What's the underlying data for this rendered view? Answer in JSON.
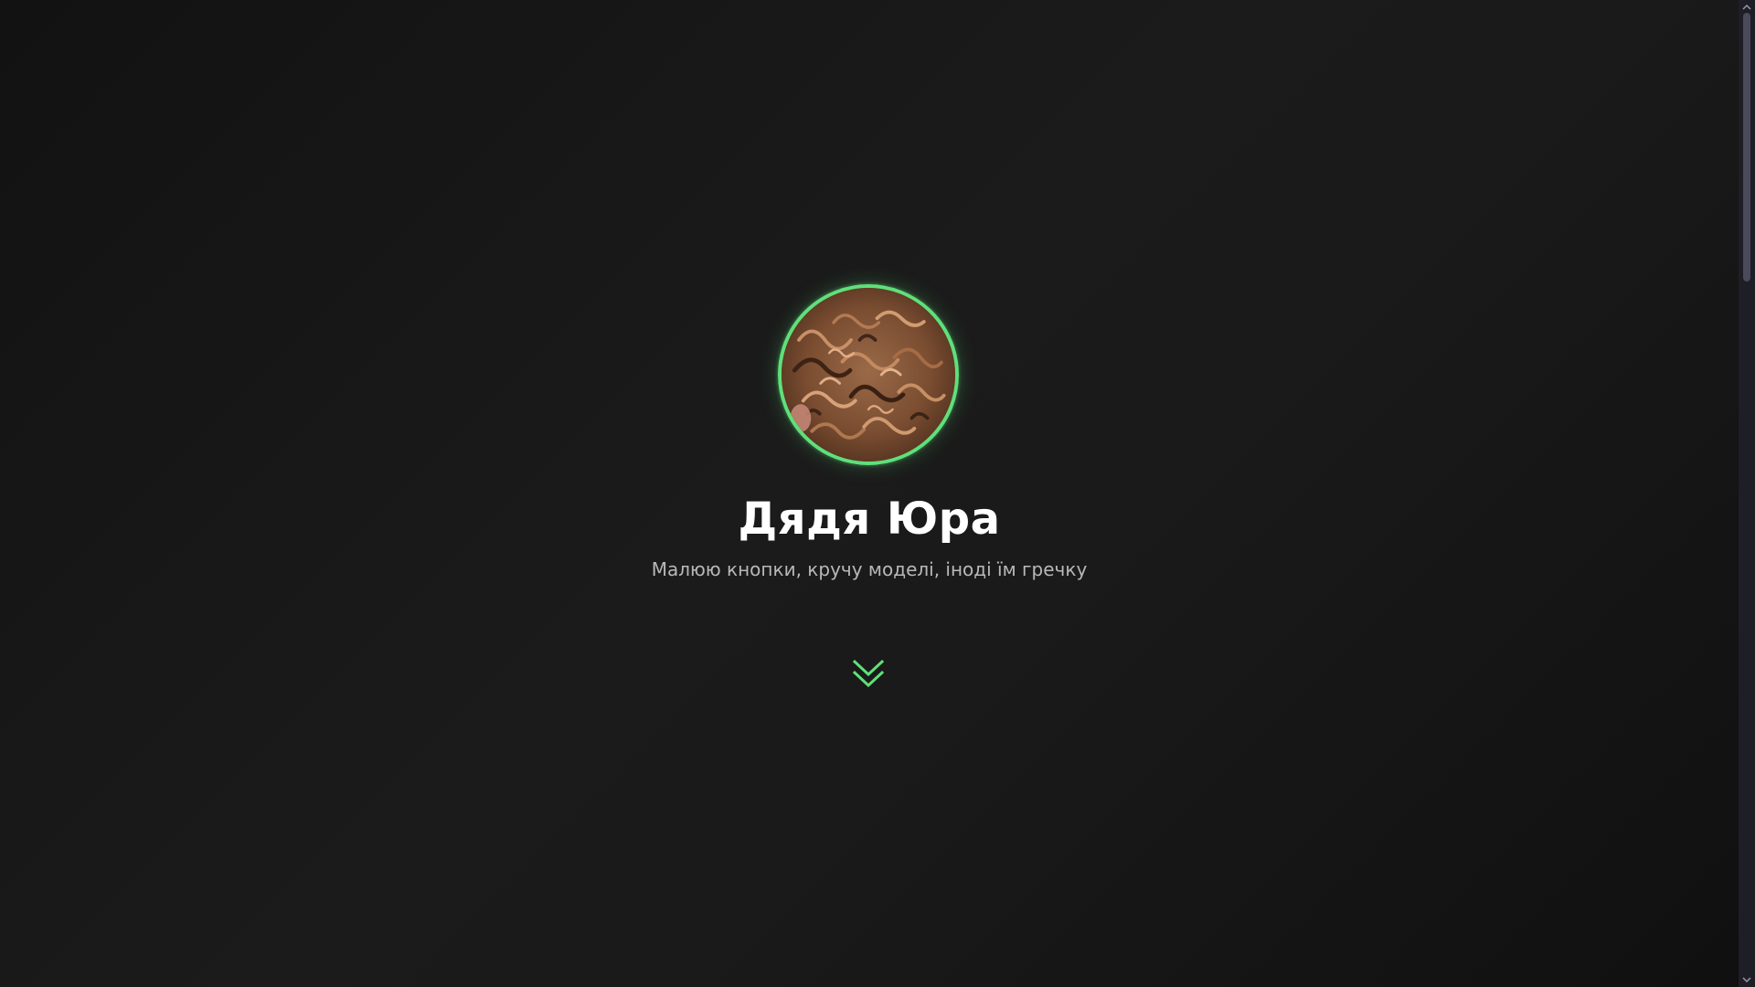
{
  "profile": {
    "name": "Дядя Юра",
    "tagline": "Малюю кнопки, кручу моделі, іноді їм гречку",
    "avatar_icon": "avatar-curly-hair-photo"
  },
  "scroll_hint": {
    "icon": "double-chevron-down-icon"
  },
  "colors": {
    "accent": "#5fe07a",
    "background": "#161616",
    "name_text": "#ffffff",
    "tagline_text": "#b8b8b8",
    "scrollbar_track": "#1e1e26",
    "scrollbar_thumb": "#4a4a5a"
  }
}
